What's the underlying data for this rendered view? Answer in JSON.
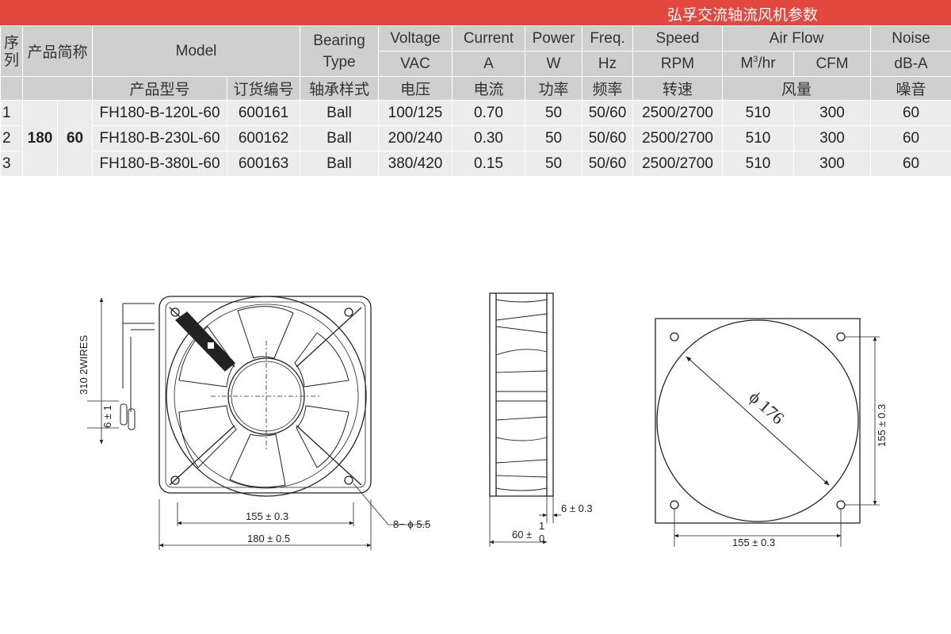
{
  "title": "弘孚交流轴流风机参数",
  "header": {
    "seq": "序列",
    "abbr": "产品简称",
    "model_en": "Model",
    "bearing_en": "Bearing Type",
    "voltage_en": "Voltage",
    "current_en": "Current",
    "power_en": "Power",
    "freq_en": "Freq.",
    "speed_en": "Speed",
    "airflow_en": "Air Flow",
    "noise_en": "Noise",
    "unit_vac": "VAC",
    "unit_a": "A",
    "unit_w": "W",
    "unit_hz": "Hz",
    "unit_rpm": "RPM",
    "unit_m3_base": "M",
    "unit_m3_sup": "3",
    "unit_m3_tail": "/hr",
    "unit_cfm": "CFM",
    "unit_dba": "dB-A",
    "cn_model": "产品型号",
    "cn_order": "订货编号",
    "cn_bearing": "轴承样式",
    "cn_voltage": "电压",
    "cn_current": "电流",
    "cn_power": "功率",
    "cn_freq": "频率",
    "cn_speed": "转速",
    "cn_airflow": "风量",
    "cn_noise": "噪音"
  },
  "abbr_size": "180",
  "abbr_depth": "60",
  "rows": [
    {
      "seq": "1",
      "model": "FH180-B-120L-60",
      "order": "600161",
      "bearing": "Ball",
      "voltage": "100/125",
      "current": "0.70",
      "power": "50",
      "freq": "50/60",
      "speed": "2500/2700",
      "m3hr": "510",
      "cfm": "300",
      "noise": "60"
    },
    {
      "seq": "2",
      "model": "FH180-B-230L-60",
      "order": "600162",
      "bearing": "Ball",
      "voltage": "200/240",
      "current": "0.30",
      "power": "50",
      "freq": "50/60",
      "speed": "2500/2700",
      "m3hr": "510",
      "cfm": "300",
      "noise": "60"
    },
    {
      "seq": "3",
      "model": "FH180-B-380L-60",
      "order": "600163",
      "bearing": "Ball",
      "voltage": "380/420",
      "current": "0.15",
      "power": "50",
      "freq": "50/60",
      "speed": "2500/2700",
      "m3hr": "510",
      "cfm": "300",
      "noise": "60"
    }
  ],
  "drawing": {
    "wires_label": "310  2WIRES",
    "lead_dim": "6 ± 1",
    "front_hole_spacing": "155 ± 0.3",
    "front_size": "180 ± 0.5",
    "hole_callout": "8− ϕ 5.5",
    "side_flange": "6 ± 0.3",
    "side_depth": "60 ± ",
    "side_tol_plus": "1",
    "side_tol_minus": "0",
    "cutout_dia": "ϕ 176",
    "cutout_h_spacing": "155 ± 0.3",
    "cutout_v_spacing": "155 ± 0.3"
  }
}
